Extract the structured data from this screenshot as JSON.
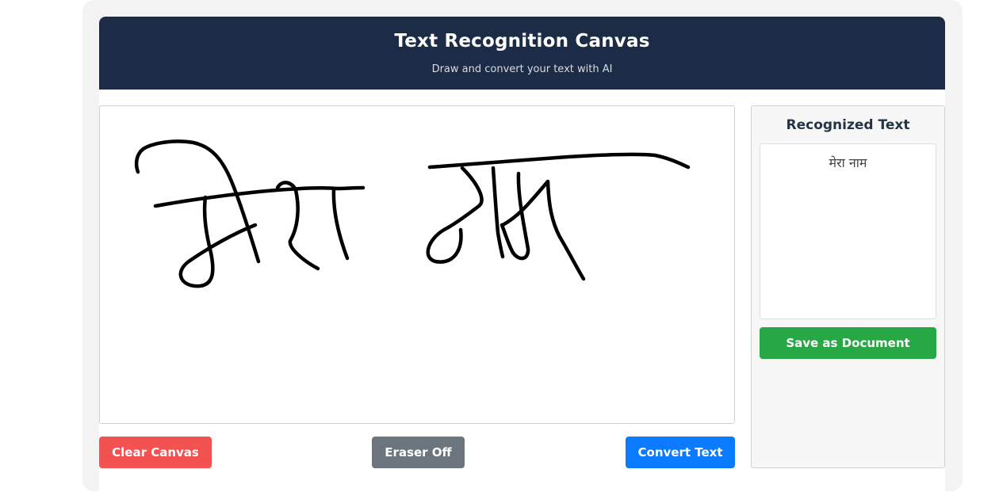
{
  "header": {
    "title": "Text Recognition Canvas",
    "subtitle": "Draw and convert your text with AI"
  },
  "canvas": {
    "stroke_color": "#000000"
  },
  "controls": {
    "clear_label": "Clear Canvas",
    "eraser_label": "Eraser Off",
    "convert_label": "Convert Text"
  },
  "result_panel": {
    "title": "Recognized Text",
    "text": "मेरा नाम",
    "save_label": "Save as Document"
  },
  "colors": {
    "header_bg": "#1c2b46",
    "clear": "#f45151",
    "eraser": "#6c757d",
    "convert": "#0a7bff",
    "save": "#28a745"
  }
}
